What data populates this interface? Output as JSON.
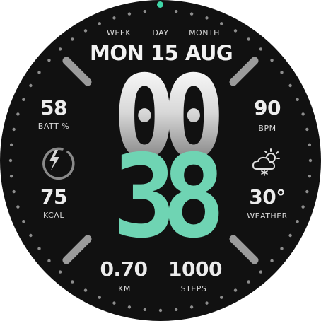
{
  "date": {
    "week_label": "WEEK",
    "day_label": "DAY",
    "month_label": "MONTH",
    "text": "MON 15 AUG"
  },
  "time": {
    "hours": "00",
    "minutes": "38"
  },
  "left": {
    "battery_value": "58",
    "battery_label": "BATT %",
    "battery_icon": "battery-charging-icon",
    "calories_value": "75",
    "calories_label": "KCAL"
  },
  "right": {
    "heart_value": "90",
    "heart_label": "BPM",
    "weather_icon": "partly-cloudy-snow-icon",
    "temp_value": "30°",
    "temp_label": "WEATHER"
  },
  "bottom": {
    "distance_value": "0.70",
    "distance_label": "KM",
    "steps_value": "1000",
    "steps_label": "STEPS"
  },
  "colors": {
    "background": "#111111",
    "accent": "#6fd4b3",
    "text": "#e9e9e9",
    "indicator_dot": "#3fd5a7"
  }
}
